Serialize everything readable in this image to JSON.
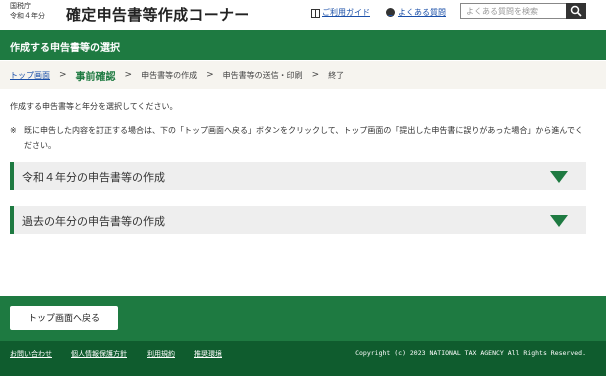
{
  "header": {
    "agency_line1": "国税庁",
    "agency_line2": "令和４年分",
    "app_title": "確定申告書等作成コーナー",
    "guide_link": "ご利用ガイド",
    "faq_link": "よくある質問",
    "search_placeholder": "よくある質問を検索"
  },
  "page_title": "作成する申告書等の選択",
  "breadcrumb": {
    "items": [
      {
        "label": "トップ画面"
      },
      {
        "label": "事前確認"
      },
      {
        "label": "申告書等の作成"
      },
      {
        "label": "申告書等の送信・印刷"
      },
      {
        "label": "終了"
      }
    ],
    "separator": ">"
  },
  "main": {
    "intro": "作成する申告書等と年分を選択してください。",
    "note_mark": "※",
    "note": "既に申告した内容を訂正する場合は、下の「トップ画面へ戻る」ボタンをクリックして、トップ画面の「提出した申告書に誤りがあった場合」から進んでください。",
    "accordions": [
      {
        "label": "令和４年分の申告書等の作成"
      },
      {
        "label": "過去の年分の申告書等の作成"
      }
    ]
  },
  "footer": {
    "back_button": "トップ画面へ戻る",
    "links": [
      "お問い合わせ",
      "個人情報保護方針",
      "利用規約",
      "推奨環境"
    ],
    "copyright": "Copyright (c) 2023 NATIONAL TAX AGENCY All Rights Reserved."
  },
  "colors": {
    "brand_green": "#1e7a41",
    "footer_dark": "#0f5c2e",
    "link_blue": "#1a4fa8"
  },
  "icons": {
    "guide": "book-icon",
    "faq": "question-circle-icon",
    "search": "search-icon",
    "accordion": "triangle-down-icon"
  }
}
